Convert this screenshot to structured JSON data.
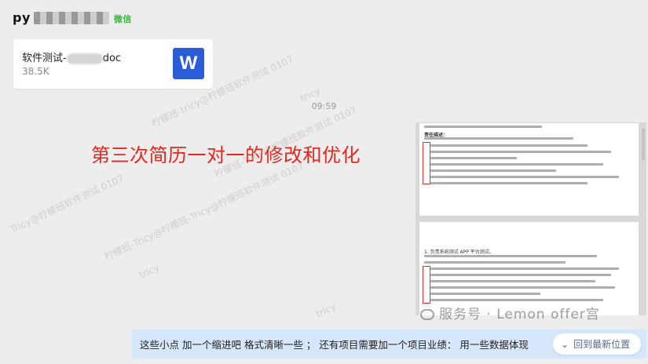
{
  "header": {
    "title_prefix": "py",
    "title_suffix": "微信"
  },
  "file_card": {
    "name_prefix": "软件测试-",
    "name_suffix": "doc",
    "size": "38.5K",
    "icon_letter": "W"
  },
  "timestamp": "09:59",
  "image_caption": "第三次简历一对一的修改和优化",
  "doc_preview": {
    "page1_heading": "责任描述：",
    "page2_heading": "1. 负责系统测试 APP 平台测试。"
  },
  "bottom_message": "这些小点 加一个缩进吧  格式清晰一些 ；  还有项目需要加一个项目业绩： 用一些数据体现",
  "latest_button": "回到最新位置",
  "brand_watermark": "服务号 · Lemon offer宫",
  "watermarks": [
    "柠檬班-tricy@柠檬班软件测试 0107",
    "tricy",
    "Tricy@柠檬班软件测试 0107",
    "柠檬班-Tricy@柠檬班软件测试 0107",
    "柠檬班-Tricy@柠檬班-Tricy@柠檬班软件测试 0107",
    "tricy",
    "tricy"
  ],
  "colors": {
    "background": "#ededed",
    "caption_red": "#e8261b",
    "word_blue": "#2b5ed6",
    "bottom_bar": "#d7e7fb",
    "link": "#576b95"
  },
  "icons": {
    "file_type": "word-icon",
    "scroll_down": "chevron-down-icon",
    "brand": "wechat-icon"
  }
}
